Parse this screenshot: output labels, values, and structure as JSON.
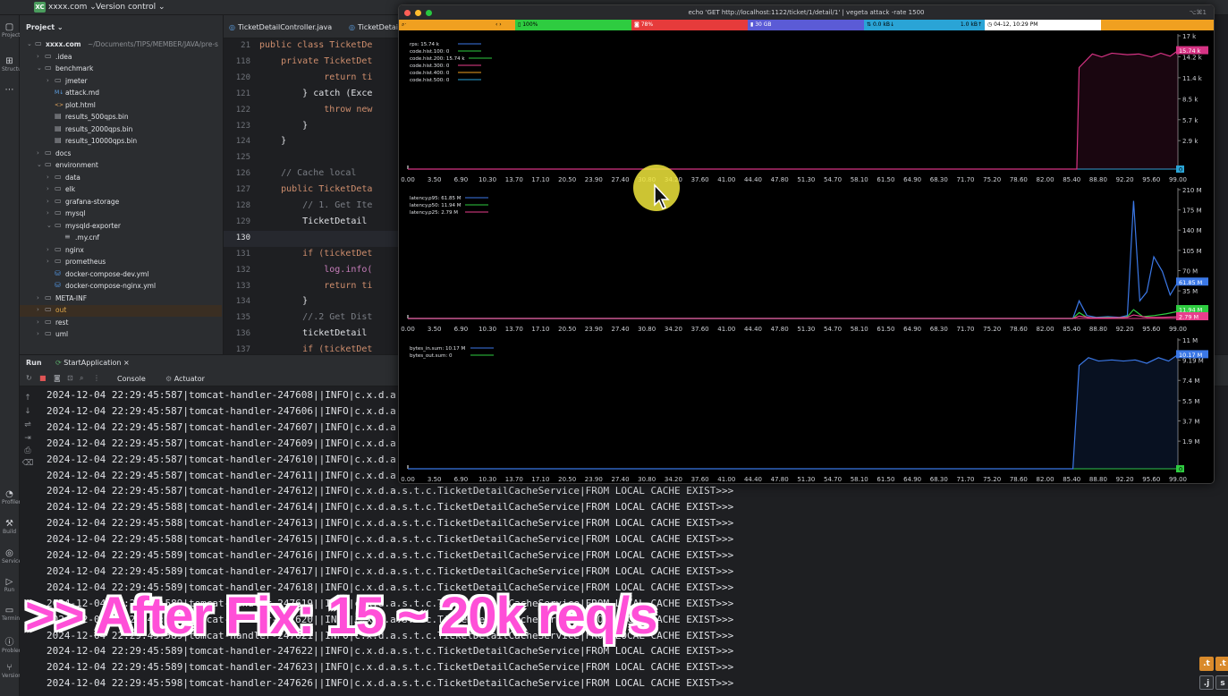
{
  "topbar": {
    "badge": "XC",
    "project": "xxxx.com ⌄",
    "vcs": "Version control ⌄"
  },
  "project_panel": {
    "title": "Project ⌄",
    "tree": [
      {
        "label": "xxxx.com",
        "extra": "~/Documents/TIPS/MEMBER/JAVA/pre-s",
        "indent": 0,
        "open": true,
        "kind": "folder"
      },
      {
        "label": ".idea",
        "indent": 1,
        "open": false,
        "kind": "folder"
      },
      {
        "label": "benchmark",
        "indent": 1,
        "open": true,
        "kind": "folder"
      },
      {
        "label": "jmeter",
        "indent": 2,
        "open": false,
        "kind": "folder"
      },
      {
        "label": "attack.md",
        "indent": 2,
        "kind": "md"
      },
      {
        "label": "plot.html",
        "indent": 2,
        "kind": "html"
      },
      {
        "label": "results_500qps.bin",
        "indent": 2,
        "kind": "file"
      },
      {
        "label": "results_2000qps.bin",
        "indent": 2,
        "kind": "file"
      },
      {
        "label": "results_10000qps.bin",
        "indent": 2,
        "kind": "file"
      },
      {
        "label": "docs",
        "indent": 1,
        "open": false,
        "kind": "folder"
      },
      {
        "label": "environment",
        "indent": 1,
        "open": true,
        "kind": "folder"
      },
      {
        "label": "data",
        "indent": 2,
        "open": false,
        "kind": "folder"
      },
      {
        "label": "elk",
        "indent": 2,
        "open": false,
        "kind": "folder"
      },
      {
        "label": "grafana-storage",
        "indent": 2,
        "open": false,
        "kind": "folder"
      },
      {
        "label": "mysql",
        "indent": 2,
        "open": false,
        "kind": "folder"
      },
      {
        "label": "mysqld-exporter",
        "indent": 2,
        "open": true,
        "kind": "folder"
      },
      {
        "label": ".my.cnf",
        "indent": 3,
        "kind": "cfg"
      },
      {
        "label": "nginx",
        "indent": 2,
        "open": false,
        "kind": "folder"
      },
      {
        "label": "prometheus",
        "indent": 2,
        "open": false,
        "kind": "folder"
      },
      {
        "label": "docker-compose-dev.yml",
        "indent": 2,
        "kind": "yml"
      },
      {
        "label": "docker-compose-nginx.yml",
        "indent": 2,
        "kind": "yml"
      },
      {
        "label": "META-INF",
        "indent": 1,
        "open": false,
        "kind": "folder"
      },
      {
        "label": "out",
        "indent": 1,
        "open": false,
        "kind": "folder",
        "selected": true
      },
      {
        "label": "rest",
        "indent": 1,
        "open": false,
        "kind": "folder"
      },
      {
        "label": "uml",
        "indent": 1,
        "open": false,
        "kind": "folder"
      }
    ]
  },
  "editor": {
    "tabs": [
      "TicketDetailController.java",
      "TicketDetail"
    ],
    "lines": [
      {
        "n": "21",
        "t": "public class TicketDe",
        "cls": "kw"
      },
      {
        "n": "118",
        "t": "    private TicketDet",
        "cls": "kw"
      },
      {
        "n": "120",
        "t": "            return ti",
        "cls": "kw"
      },
      {
        "n": "121",
        "t": "        } catch (Exce",
        "cls": "ty"
      },
      {
        "n": "122",
        "t": "            throw new",
        "cls": "kw"
      },
      {
        "n": "123",
        "t": "        }",
        "cls": "ty"
      },
      {
        "n": "124",
        "t": "    }",
        "cls": "ty"
      },
      {
        "n": "125",
        "t": "",
        "cls": "ty"
      },
      {
        "n": "126",
        "t": "    // Cache local",
        "cls": "cm"
      },
      {
        "n": "127",
        "t": "    public TicketDeta",
        "cls": "kw"
      },
      {
        "n": "128",
        "t": "        // 1. Get Ite",
        "cls": "cm"
      },
      {
        "n": "129",
        "t": "        TicketDetail ",
        "cls": "ty"
      },
      {
        "n": "130",
        "t": "",
        "cls": "ty"
      },
      {
        "n": "131",
        "t": "        if (ticketDet",
        "cls": "kw"
      },
      {
        "n": "132",
        "t": "            log.info(",
        "cls": "fd"
      },
      {
        "n": "133",
        "t": "            return ti",
        "cls": "kw"
      },
      {
        "n": "134",
        "t": "        }",
        "cls": "ty"
      },
      {
        "n": "135",
        "t": "        //.2 Get Dist",
        "cls": "cm"
      },
      {
        "n": "136",
        "t": "        ticketDetail ",
        "cls": "ty"
      },
      {
        "n": "137",
        "t": "        if (ticketDet",
        "cls": "kw"
      }
    ]
  },
  "run": {
    "label": "Run",
    "config": "StartApplication ×",
    "console_tab": "Console",
    "actuator_tab": "Actuator"
  },
  "console_lines": [
    "2024-12-04 22:29:45:587|tomcat-handler-247608||INFO|c.x.d.a.s",
    "2024-12-04 22:29:45:587|tomcat-handler-247606||INFO|c.x.d.a.s",
    "2024-12-04 22:29:45:587|tomcat-handler-247607||INFO|c.x.d.a.s",
    "2024-12-04 22:29:45:587|tomcat-handler-247609||INFO|c.x.d.a.s",
    "2024-12-04 22:29:45:587|tomcat-handler-247610||INFO|c.x.d.a.s",
    "2024-12-04 22:29:45:587|tomcat-handler-247611||INFO|c.x.d.a.s",
    "2024-12-04 22:29:45:587|tomcat-handler-247612||INFO|c.x.d.a.s.t.c.TicketDetailCacheService|FROM LOCAL CACHE EXIST>>>",
    "2024-12-04 22:29:45:588|tomcat-handler-247614||INFO|c.x.d.a.s.t.c.TicketDetailCacheService|FROM LOCAL CACHE EXIST>>>",
    "2024-12-04 22:29:45:588|tomcat-handler-247613||INFO|c.x.d.a.s.t.c.TicketDetailCacheService|FROM LOCAL CACHE EXIST>>>",
    "2024-12-04 22:29:45:588|tomcat-handler-247615||INFO|c.x.d.a.s.t.c.TicketDetailCacheService|FROM LOCAL CACHE EXIST>>>",
    "2024-12-04 22:29:45:589|tomcat-handler-247616||INFO|c.x.d.a.s.t.c.TicketDetailCacheService|FROM LOCAL CACHE EXIST>>>",
    "2024-12-04 22:29:45:589|tomcat-handler-247617||INFO|c.x.d.a.s.t.c.TicketDetailCacheService|FROM LOCAL CACHE EXIST>>>",
    "2024-12-04 22:29:45:589|tomcat-handler-247618||INFO|c.x.d.a.s.t.c.TicketDetailCacheService|FROM LOCAL CACHE EXIST>>>",
    "2024-12-04 22:29:45:589|tomcat-handler-247619||INFO|c.x.d.a.s.t.c.TicketDetailCacheService|FROM LOCAL CACHE EXIST>>>",
    "2024-12-04 22:29:45:589|tomcat-handler-247620||INFO|c.x.d.a.s.t.c.TicketDetailCacheService|FROM LOCAL CACHE EXIST>>>",
    "2024-12-04 22:29:45:589|tomcat-handler-247621||INFO|c.x.d.a.s.t.c.TicketDetailCacheService|FROM LOCAL CACHE EXIST>>>",
    "2024-12-04 22:29:45:589|tomcat-handler-247622||INFO|c.x.d.a.s.t.c.TicketDetailCacheService|FROM LOCAL CACHE EXIST>>>",
    "2024-12-04 22:29:45:589|tomcat-handler-247623||INFO|c.x.d.a.s.t.c.TicketDetailCacheService|FROM LOCAL CACHE EXIST>>>",
    "2024-12-04 22:29:45:598|tomcat-handler-247626||INFO|c.x.d.a.s.t.c.TicketDetailCacheService|FROM LOCAL CACHE EXIST>>>"
  ],
  "left_strip": [
    {
      "glyph": "▢",
      "label": "Project"
    },
    {
      "glyph": "⊞",
      "label": "Structure"
    },
    {
      "glyph": "⋯",
      "label": ""
    },
    {
      "glyph": "◔",
      "label": "Profiler"
    },
    {
      "glyph": "⚒",
      "label": "Build"
    },
    {
      "glyph": "◎",
      "label": "Services"
    },
    {
      "glyph": "▷",
      "label": "Run"
    },
    {
      "glyph": "▭",
      "label": "Terminal"
    },
    {
      "glyph": "ⓘ",
      "label": "Problems"
    },
    {
      "glyph": "⑂",
      "label": "Version"
    }
  ],
  "overlay": {
    "text": ">> After Fix: 15 ~ 20k req/s"
  },
  "terminal": {
    "title": "echo 'GET http://localhost:1122/ticket/1/detail/1' | vegeta attack -rate 1500",
    "shortcut": "⌥⌘1",
    "status": {
      "cpu": "100%",
      "mem": "78%",
      "disk": "30 GB",
      "net_in": "0.0 kB↓",
      "net_out": "1.0 kB↑",
      "clock": "◷ 04-12, 10:29 PM"
    },
    "colors": {
      "rps": "#d63384",
      "p95": "#3b78e7",
      "p50": "#2ecc40",
      "p25": "#e83e8c",
      "bytes_in": "#3b78e7",
      "bytes_out": "#2ecc40"
    }
  },
  "chart_data": [
    {
      "type": "area",
      "legend": [
        "rps: 15.74 k",
        "code.hist.100: 0",
        "code.hist.200: 15.74 k",
        "code.hist.300: 0",
        "code.hist.400: 0",
        "code.hist.500: 0"
      ],
      "y_ticks": [
        "17 k",
        "14.2 k",
        "11.4 k",
        "8.5 k",
        "5.7 k",
        "2.9 k"
      ],
      "ylim": [
        0,
        17000
      ],
      "current_label": "15.74 k",
      "zero_label": "0",
      "x_ticks": [
        "0.00",
        "3.50",
        "6.90",
        "10.30",
        "13.70",
        "17.10",
        "20.50",
        "23.90",
        "27.40",
        "30.80",
        "34.20",
        "37.60",
        "41.00",
        "44.40",
        "47.80",
        "51.30",
        "54.70",
        "58.10",
        "61.50",
        "64.90",
        "68.30",
        "71.70",
        "75.20",
        "78.60",
        "82.00",
        "85.40",
        "88.80",
        "92.20",
        "95.60",
        "99.00"
      ],
      "xlim": [
        0,
        99
      ],
      "series": [
        {
          "name": "rps",
          "x": [
            0,
            86.0,
            86.3,
            88.0,
            89.2,
            90.5,
            92.5,
            94.0,
            95.6,
            96.8,
            98.0,
            99.0
          ],
          "values": [
            0,
            0,
            13500,
            15300,
            14900,
            15400,
            15200,
            15300,
            14900,
            15400,
            15000,
            15740
          ]
        }
      ]
    },
    {
      "type": "line",
      "legend": [
        "latency.p95: 61.85 M",
        "latency.p50: 11.94 M",
        "latency.p25: 2.79 M"
      ],
      "y_ticks": [
        "210 M",
        "175 M",
        "140 M",
        "105 M",
        "70 M",
        "35 M"
      ],
      "ylim": [
        0,
        210
      ],
      "current_labels": [
        "61.85 M",
        "11.94 M",
        "2.79 M"
      ],
      "x_ticks": [
        "0.00",
        "3.50",
        "6.90",
        "10.30",
        "13.70",
        "17.10",
        "20.50",
        "23.90",
        "27.40",
        "30.80",
        "34.20",
        "37.60",
        "41.00",
        "44.40",
        "47.80",
        "51.30",
        "54.70",
        "58.10",
        "61.50",
        "64.90",
        "68.30",
        "71.70",
        "75.20",
        "78.60",
        "82.00",
        "85.40",
        "88.80",
        "92.20",
        "95.60",
        "99.00"
      ],
      "xlim": [
        0,
        99
      ],
      "series": [
        {
          "name": "latency.p95",
          "x": [
            0,
            85.5,
            86.3,
            87.3,
            88.5,
            90.0,
            91.5,
            92.5,
            93.3,
            94.1,
            95.0,
            95.9,
            97.0,
            98.0,
            99.0
          ],
          "values": [
            0,
            0,
            30,
            5,
            2,
            3,
            2,
            5,
            200,
            30,
            45,
            105,
            80,
            40,
            62
          ]
        },
        {
          "name": "latency.p50",
          "x": [
            0,
            85.5,
            86.3,
            87.3,
            88.5,
            90.0,
            91.5,
            92.5,
            93.3,
            94.5,
            96.0,
            97.5,
            99.0
          ],
          "values": [
            0,
            0,
            10,
            2,
            1,
            2,
            1,
            3,
            15,
            3,
            5,
            8,
            12
          ]
        },
        {
          "name": "latency.p25",
          "x": [
            0,
            85.5,
            86.3,
            88.0,
            90.0,
            92.5,
            93.3,
            95.0,
            97.0,
            99.0
          ],
          "values": [
            0,
            0,
            4,
            1,
            1,
            2,
            6,
            2,
            2,
            2.8
          ]
        }
      ]
    },
    {
      "type": "area",
      "legend": [
        "bytes_in.sum: 10.17 M",
        "bytes_out.sum: 0"
      ],
      "y_ticks": [
        "11 M",
        "9.19 M",
        "7.4 M",
        "5.5 M",
        "3.7 M",
        "1.9 M"
      ],
      "ylim": [
        0,
        11
      ],
      "current_label": "10.17 M",
      "zero_label": "0",
      "x_ticks": [
        "0.00",
        "3.50",
        "6.90",
        "10.30",
        "13.70",
        "17.10",
        "20.50",
        "23.90",
        "27.40",
        "30.80",
        "34.20",
        "37.60",
        "41.00",
        "44.40",
        "47.80",
        "51.30",
        "54.70",
        "58.10",
        "61.50",
        "64.90",
        "68.30",
        "71.70",
        "75.20",
        "78.60",
        "82.00",
        "85.40",
        "88.80",
        "92.20",
        "95.60",
        "99.00"
      ],
      "xlim": [
        0,
        99
      ],
      "series": [
        {
          "name": "bytes_in.sum",
          "x": [
            0,
            85.5,
            86.3,
            87.5,
            88.8,
            90.5,
            92.0,
            93.5,
            95.0,
            96.5,
            97.8,
            99.0
          ],
          "values": [
            0,
            0,
            9.2,
            9.9,
            9.6,
            9.7,
            9.6,
            9.7,
            9.4,
            9.9,
            9.6,
            10.17
          ]
        }
      ]
    }
  ]
}
